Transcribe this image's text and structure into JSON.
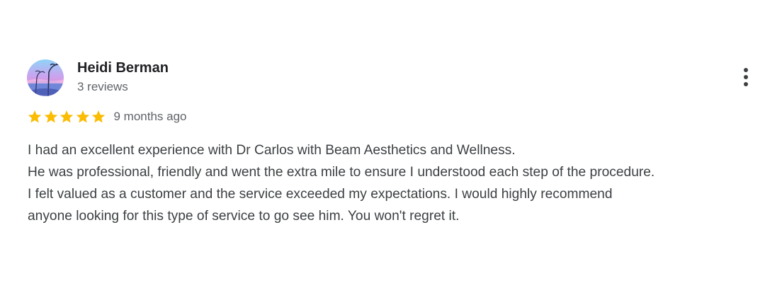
{
  "review": {
    "author": {
      "name": "Heidi Berman",
      "reviews_count": "3 reviews",
      "avatar_icon": "profile-photo-icon"
    },
    "rating": 5,
    "rating_max": 5,
    "star_color": "#fbbc04",
    "date": "9 months ago",
    "text_lines": [
      "I had an excellent experience with Dr Carlos with Beam Aesthetics and Wellness.",
      "He was professional, friendly and went the extra mile to ensure I understood each step of the procedure.",
      "I felt valued as a customer and the service exceeded my expectations. I would highly recommend",
      "anyone looking for this type of service to go see him. You won't regret it."
    ],
    "more_icon": "more-vert-icon"
  }
}
